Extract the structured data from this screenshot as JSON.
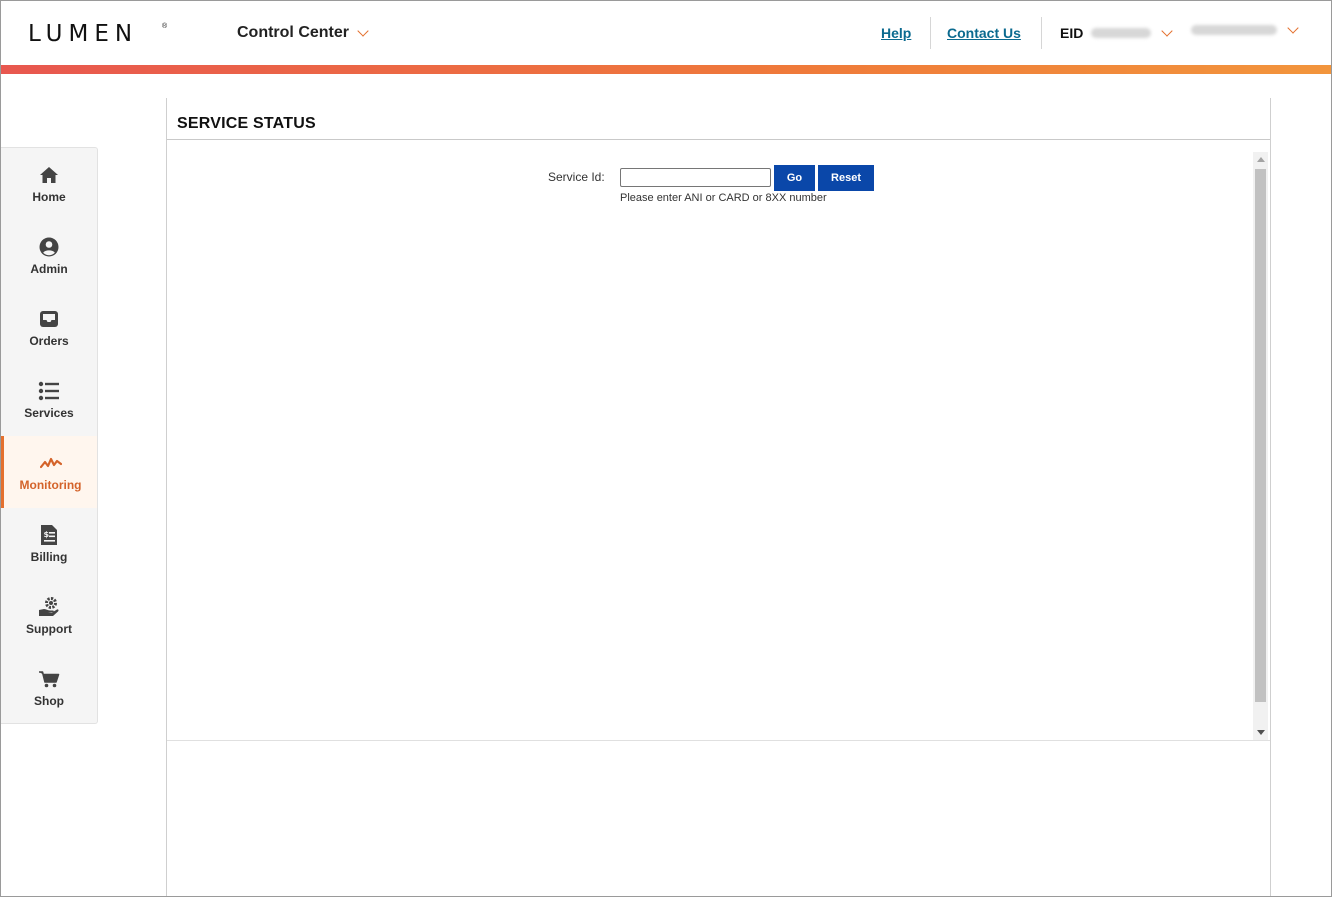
{
  "header": {
    "logo_text": "LUMEN",
    "logo_mark": "®",
    "app_menu_label": "Control Center",
    "help_label": "Help",
    "contact_label": "Contact Us",
    "eid_label": "EID",
    "accent_color": "#e4702e",
    "link_color": "#0b6a8f"
  },
  "sidebar": {
    "items": [
      {
        "label": "Home",
        "icon": "home-icon"
      },
      {
        "label": "Admin",
        "icon": "user-circle-icon"
      },
      {
        "label": "Orders",
        "icon": "inbox-icon"
      },
      {
        "label": "Services",
        "icon": "list-icon"
      },
      {
        "label": "Monitoring",
        "icon": "pulse-icon",
        "active": true
      },
      {
        "label": "Billing",
        "icon": "invoice-icon"
      },
      {
        "label": "Support",
        "icon": "support-icon"
      },
      {
        "label": "Shop",
        "icon": "cart-icon"
      }
    ]
  },
  "main": {
    "title": "SERVICE STATUS",
    "service_id_label": "Service Id:",
    "service_id_value": "",
    "go_label": "Go",
    "reset_label": "Reset",
    "hint": "Please enter ANI or CARD or 8XX number",
    "button_color": "#0a47a9"
  }
}
